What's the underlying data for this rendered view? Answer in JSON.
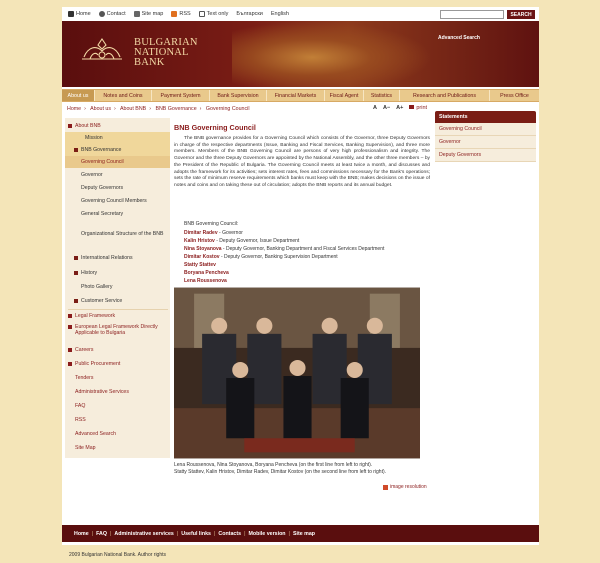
{
  "topbar": {
    "items": [
      "Home",
      "Contact",
      "Site map",
      "RSS",
      "Text only",
      "Български",
      "English"
    ],
    "search_button": "SEARCH"
  },
  "banner": {
    "logo_line1": "BULGARIAN",
    "logo_line2": "NATIONAL",
    "logo_line3": "BANK",
    "advanced_search": "Advanced Search"
  },
  "mainnav": [
    "About us",
    "Notes and Coins",
    "Payment System",
    "Bank Supervision",
    "Financial Markets",
    "Fiscal Agent",
    "Statistics",
    "Research and Publications",
    "Press Office"
  ],
  "breadcrumb": [
    "Home",
    "About us",
    "About BNB",
    "BNB Governance",
    "Governing Council"
  ],
  "tools": {
    "a_minus": "A",
    "a_norm": "A−",
    "a_plus": "A+",
    "print": "print"
  },
  "sidebar": [
    {
      "label": "About BNB"
    },
    {
      "label": "Mission"
    },
    {
      "label": "BNB Governance"
    },
    {
      "label": "Governing Council"
    },
    {
      "label": "Governor"
    },
    {
      "label": "Deputy Governors"
    },
    {
      "label": "Governing Council Members"
    },
    {
      "label": "General Secretary"
    },
    {
      "label": "Organizational Structure of the BNB"
    },
    {
      "label": "International Relations"
    },
    {
      "label": "History"
    },
    {
      "label": "Photo Gallery"
    },
    {
      "label": "Customer Service"
    },
    {
      "label": "Legal Framework"
    },
    {
      "label": "European Legal Framework Directly Applicable to Bulgaria"
    },
    {
      "label": "Careers"
    },
    {
      "label": "Public Procurement"
    },
    {
      "label": "Tenders"
    },
    {
      "label": "Administrative Services"
    },
    {
      "label": "FAQ"
    },
    {
      "label": "RSS"
    },
    {
      "label": "Advanced Search"
    },
    {
      "label": "Site Map"
    }
  ],
  "content": {
    "title": "BNB Governing Council",
    "paragraph": "The BNB governance provides for a Governing Council which consists of the Governor, three Deputy Governors in charge of the respective departments (Issue, Banking and Fiscal Services, Banking Supervision), and three more members. Members of the BNB Governing Council are persons of very high professionalism and integrity. The Governor and the three Deputy Governors are appointed by the National Assembly, and the other three members – by the President of the Republic of Bulgaria. The Governing Council meets at least twice a month, and discusses and adopts the framework for its activities; sets interest rates, fees and commissions necessary for the Bank's operations; sets the rate of minimum reserve requirements which banks must keep with the BNB; makes decisions on the issue of notes and coins and on taking these out of circulation; adopts the BNB reports and its annual budget.",
    "council_label": "BNB Governing Council:",
    "members": [
      {
        "name": "Dimitar Radev",
        "role": " - Governor"
      },
      {
        "name": "Kalin Hristov",
        "role": " - Deputy Governor, Issue Department"
      },
      {
        "name": "Nina Stoyanova",
        "role": " - Deputy Governor, Banking Department and Fiscal Services Department"
      },
      {
        "name": "Dimitar Kostov",
        "role": " - Deputy Governor, Banking Supervision Department"
      },
      {
        "name": "Statty Stattev",
        "role": ""
      },
      {
        "name": "Boryana Pencheva",
        "role": ""
      },
      {
        "name": "Lena Roussenova",
        "role": ""
      }
    ],
    "caption_line1": "Lena Roussenova, Nina Stoyanova, Boryana Pencheva (on the first line from left to right).",
    "caption_line2": "Statty Stattev, Kalin Hristov, Dimitar Radev, Dimitar Kostov (on the second line from left to right).",
    "image_resolution": "image resolution"
  },
  "rightside": {
    "header": "Statements",
    "items": [
      "Governing Council",
      "Governor",
      "Deputy Governors"
    ]
  },
  "footer": {
    "items": [
      "Home",
      "FAQ",
      "Administrative services",
      "Useful links",
      "Contacts",
      "Mobile version",
      "Site map"
    ],
    "copyright": "2009 Bulgarian National Bank. Author rights"
  }
}
